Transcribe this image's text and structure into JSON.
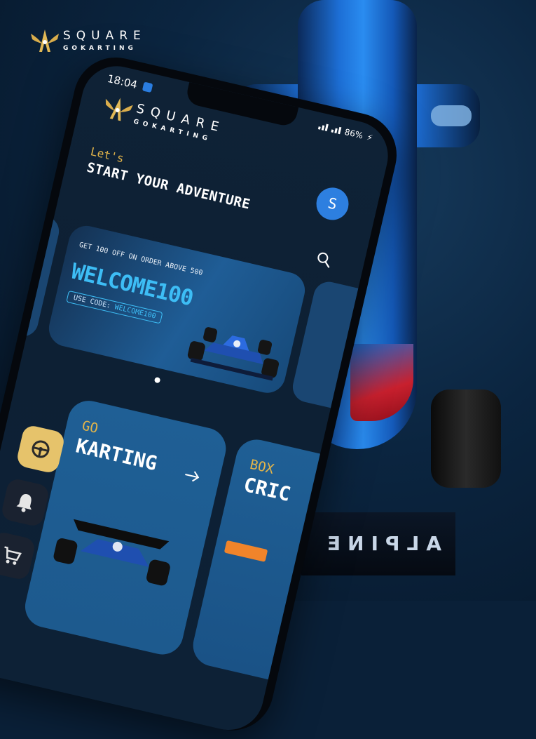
{
  "corner_logo": {
    "line1": "SQUARE",
    "line2": "GOKARTING"
  },
  "status_bar": {
    "time": "18:04",
    "battery": "86%"
  },
  "app_logo": {
    "line1": "SQUARE",
    "line2": "GOKARTING"
  },
  "avatar": {
    "initial": "S"
  },
  "greeting": {
    "small": "Let's",
    "headline": "START YOUR ADVENTURE"
  },
  "banner": {
    "offer": "GET 100 OFF ON ORDER ABOVE 500",
    "code_big": "WELCOME100",
    "use_code_label": "USE CODE:",
    "use_code_value": "WELCOME100"
  },
  "side_nav": [
    {
      "icon": "steering-wheel-icon",
      "active": true
    },
    {
      "icon": "bell-icon",
      "active": false
    },
    {
      "icon": "cart-icon",
      "active": false
    }
  ],
  "cards": [
    {
      "small": "GO",
      "title": "KARTING"
    },
    {
      "small": "BOX",
      "title": "CRIC"
    }
  ],
  "background": {
    "wing_text": "ALPINE"
  },
  "colors": {
    "accent_gold": "#e2b44a",
    "accent_blue": "#3dbdf5",
    "avatar_blue": "#2d7fe0",
    "card_blue": "#1f5f95"
  }
}
